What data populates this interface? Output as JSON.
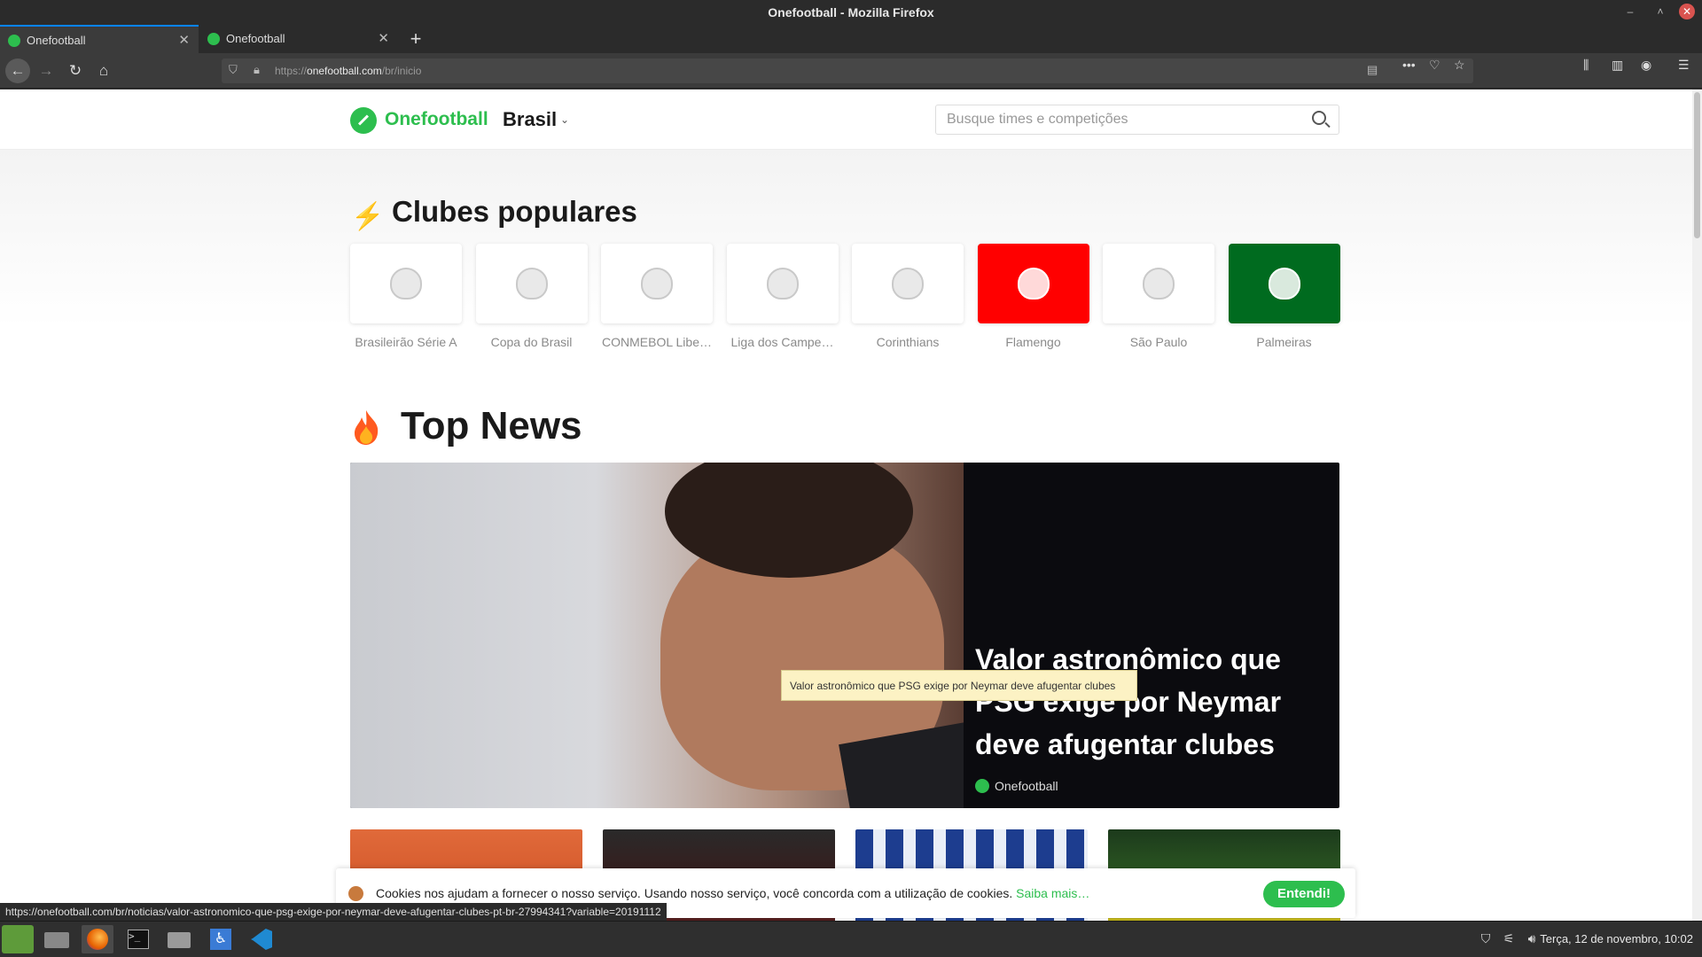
{
  "window": {
    "title": "Onefootball - Mozilla Firefox"
  },
  "tabs": [
    {
      "label": "Onefootball"
    },
    {
      "label": "Onefootball"
    }
  ],
  "navbar": {
    "url_prefix": "https://",
    "url_host": "onefootball.com",
    "url_path": "/br/inicio"
  },
  "site": {
    "brand": "Onefootball",
    "country": "Brasil",
    "search_placeholder": "Busque times e competições",
    "accent_color": "#2dbe4e"
  },
  "popular": {
    "title": "Clubes populares",
    "clubs": [
      {
        "label": "Brasileirão Série A",
        "bg": "#ffffff",
        "icon": "brasileirao-crest-icon"
      },
      {
        "label": "Copa do Brasil",
        "bg": "#ffffff",
        "icon": "copa-do-brasil-crest-icon"
      },
      {
        "label": "CONMEBOL Libe…",
        "bg": "#ffffff",
        "icon": "libertadores-crest-icon"
      },
      {
        "label": "Liga dos Campe…",
        "bg": "#ffffff",
        "icon": "champions-league-crest-icon"
      },
      {
        "label": "Corinthians",
        "bg": "#ffffff",
        "icon": "corinthians-crest-icon"
      },
      {
        "label": "Flamengo",
        "bg": "#ff0000",
        "icon": "flamengo-crest-icon"
      },
      {
        "label": "São Paulo",
        "bg": "#ffffff",
        "icon": "sao-paulo-crest-icon"
      },
      {
        "label": "Palmeiras",
        "bg": "#006b1f",
        "icon": "palmeiras-crest-icon"
      }
    ]
  },
  "news": {
    "title": "Top News",
    "hero_headline": "Valor astronômico que PSG exige por Neymar deve afugentar clubes",
    "hero_source": "Onefootball",
    "tooltip": "Valor astronômico que PSG exige por Neymar deve afugentar clubes"
  },
  "cookie": {
    "text": "Cookies nos ajudam a fornecer o nosso serviço. Usando nosso serviço, você concorda com a utilização de cookies.",
    "link": "Saiba mais…",
    "button": "Entendi!"
  },
  "status_url": "https://onefootball.com/br/noticias/valor-astronomico-que-psg-exige-por-neymar-deve-afugentar-clubes-pt-br-27994341?variable=20191112",
  "taskbar": {
    "clock": "Terça, 12 de novembro, 10:02"
  }
}
